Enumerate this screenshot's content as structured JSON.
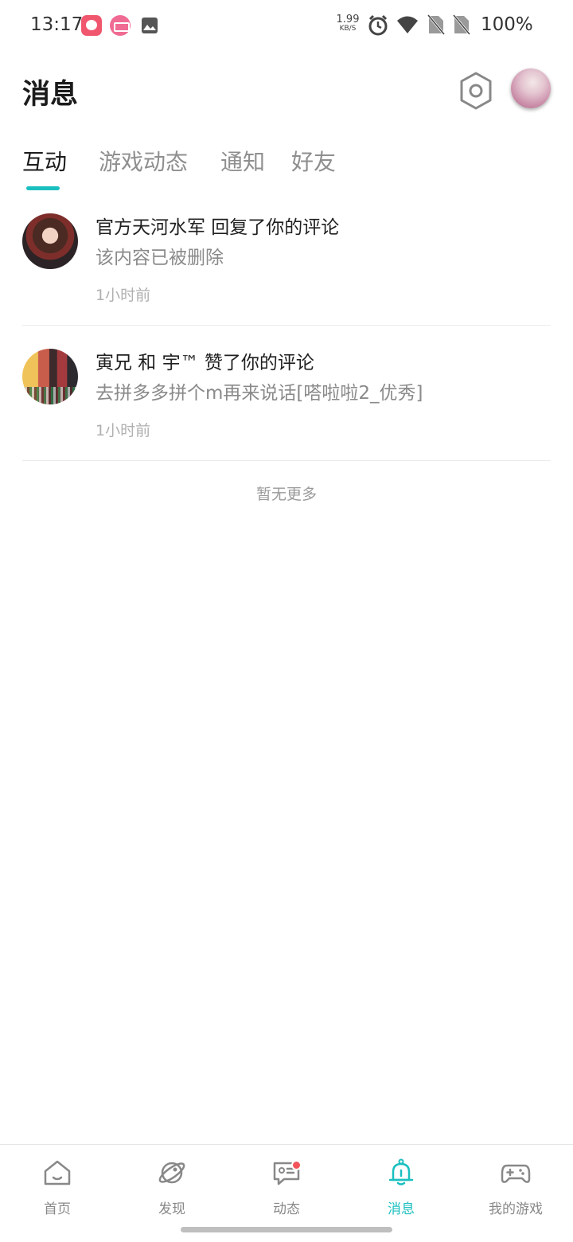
{
  "status_bar": {
    "time": "13:17",
    "net_speed_value": "1.99",
    "net_speed_unit": "KB/S",
    "battery": "100%",
    "icons": [
      "app-notification-icon",
      "bilibili-icon",
      "gallery-icon",
      "alarm-icon",
      "wifi-icon",
      "no-sim-icon",
      "no-sim-icon"
    ]
  },
  "header": {
    "title": "消息",
    "settings_icon": "hexagon-settings-icon"
  },
  "tabs": [
    {
      "label": "互动",
      "active": true
    },
    {
      "label": "游戏动态",
      "active": false
    },
    {
      "label": "通知",
      "active": false
    },
    {
      "label": "好友",
      "active": false
    }
  ],
  "messages": [
    {
      "title": "官方天河水军 回复了你的评论",
      "body": "该内容已被删除",
      "time": "1小时前"
    },
    {
      "title": "寅兄 和 宇™ 赞了你的评论",
      "body": "去拼多多拼个m再来说话[嗒啦啦2_优秀]",
      "time": "1小时前"
    }
  ],
  "list_footer": "暂无更多",
  "bottom_nav": [
    {
      "label": "首页",
      "icon": "home-icon",
      "active": false
    },
    {
      "label": "发现",
      "icon": "planet-icon",
      "active": false
    },
    {
      "label": "动态",
      "icon": "feed-chat-icon",
      "active": false,
      "badge": true
    },
    {
      "label": "消息",
      "icon": "bell-icon",
      "active": true
    },
    {
      "label": "我的游戏",
      "icon": "gamepad-icon",
      "active": false
    }
  ],
  "colors": {
    "accent": "#1bbfbf",
    "badge": "#f2545b",
    "text_secondary": "#8a8a8a"
  }
}
